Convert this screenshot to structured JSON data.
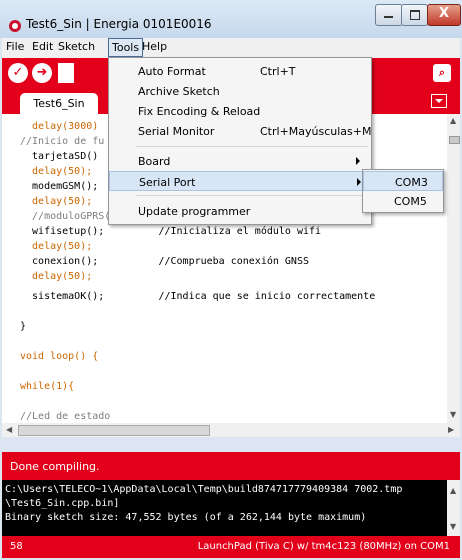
{
  "window": {
    "title": "Test6_Sin | Energia 0101E0016",
    "close_label": "X"
  },
  "menubar": {
    "items": [
      "File",
      "Edit",
      "Sketch",
      "Tools",
      "Help"
    ]
  },
  "tabs": {
    "active": "Test6_Sin"
  },
  "editor": {
    "lines": [
      "  delay(3000)",
      "//Inicio de fu",
      "  tarjetaSD()",
      "  delay(50);",
      "  modemGSM();",
      "  delay(50);",
      "  //moduloGPRS();",
      "  wifisetup();         //Inicializa el módulo wifi",
      "  delay(50);",
      "  conexion();          //Comprueba conexión GNSS",
      "  delay(50);",
      "  sistemaOK();         //Indica que se inicio correctamente",
      "",
      "}",
      "",
      "void loop() {",
      "",
      "while(1){",
      "",
      "//Led de estado"
    ]
  },
  "tools_menu": {
    "items": [
      {
        "label": "Auto Format",
        "shortcut": "Ctrl+T"
      },
      {
        "label": "Archive Sketch",
        "shortcut": ""
      },
      {
        "label": "Fix Encoding & Reload",
        "shortcut": ""
      },
      {
        "label": "Serial Monitor",
        "shortcut": "Ctrl+Mayúsculas+M"
      },
      {
        "label": "Board",
        "shortcut": ""
      },
      {
        "label": "Serial Port",
        "shortcut": ""
      },
      {
        "label": "Update programmer",
        "shortcut": ""
      }
    ]
  },
  "serial_port_menu": {
    "items": [
      "COM3",
      "COM5"
    ]
  },
  "status": {
    "message": "Done compiling."
  },
  "console": {
    "lines": [
      "C:\\Users\\TELECO~1\\AppData\\Local\\Temp\\build874717779409384 7002.tmp",
      "\\Test6_Sin.cpp.bin]",
      "Binary sketch size: 47,552 bytes (of a 262,144 byte maximum)"
    ]
  },
  "footer": {
    "line": "58",
    "board": "LaunchPad (Tiva C) w/ tm4c123 (80MHz) on COM1"
  },
  "colors": {
    "accent": "#e2001a",
    "keyword": "#cc6600",
    "comment": "#7e7e7e"
  }
}
